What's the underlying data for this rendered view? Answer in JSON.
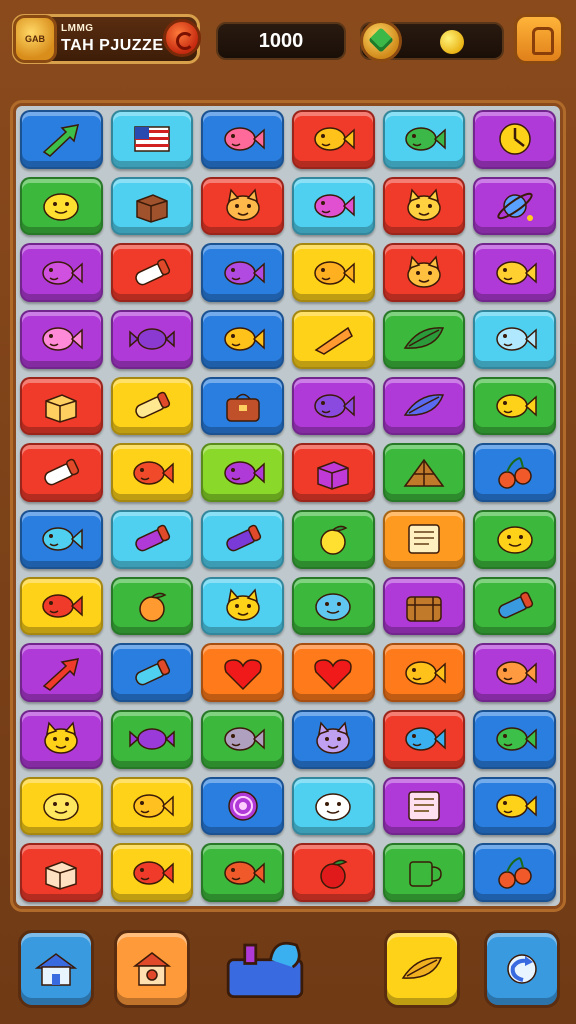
{
  "header": {
    "title_small": "LMMG",
    "title_main": "TAH PJUZZE",
    "coin_label": "GAB",
    "score": "1000"
  },
  "board": {
    "rows": 12,
    "cols": 6,
    "tiles": [
      [
        {
          "color": "#2a7ee0",
          "icon": "arrow-icon",
          "ic": "#3cc04a"
        },
        {
          "color": "#4fd0f0",
          "icon": "flag-icon",
          "ic": "#d02020"
        },
        {
          "color": "#2a7ee0",
          "icon": "fish-icon",
          "ic": "#ff6a9a"
        },
        {
          "color": "#f03a2a",
          "icon": "fish-icon",
          "ic": "#ffc21a"
        },
        {
          "color": "#4fd0f0",
          "icon": "fish-icon",
          "ic": "#3cb848"
        },
        {
          "color": "#b03ad8",
          "icon": "clock-icon",
          "ic": "#ffd21a"
        }
      ],
      [
        {
          "color": "#3cb83c",
          "icon": "blob-icon",
          "ic": "#ffe030"
        },
        {
          "color": "#4fd0f0",
          "icon": "box-icon",
          "ic": "#a0522d"
        },
        {
          "color": "#f03a2a",
          "icon": "cat-icon",
          "ic": "#ffb84a"
        },
        {
          "color": "#4fd0f0",
          "icon": "fish-icon",
          "ic": "#e050d0"
        },
        {
          "color": "#f03a2a",
          "icon": "cat-icon",
          "ic": "#ffd040"
        },
        {
          "color": "#b03ad8",
          "icon": "planet-icon",
          "ic": "#5aa0ff"
        }
      ],
      [
        {
          "color": "#b03ad8",
          "icon": "fish-icon",
          "ic": "#d050e0"
        },
        {
          "color": "#f03a2a",
          "icon": "tube-icon",
          "ic": "#ffffff"
        },
        {
          "color": "#2a7ee0",
          "icon": "fish-icon",
          "ic": "#b04ae0"
        },
        {
          "color": "#ffd21a",
          "icon": "fish-icon",
          "ic": "#ffb020"
        },
        {
          "color": "#f03a2a",
          "icon": "cat-icon",
          "ic": "#ffc040"
        },
        {
          "color": "#b03ad8",
          "icon": "fish-icon",
          "ic": "#ffd030"
        }
      ],
      [
        {
          "color": "#b03ad8",
          "icon": "fish-icon",
          "ic": "#ff8ad8"
        },
        {
          "color": "#b03ad8",
          "icon": "candy-icon",
          "ic": "#8a3ad0"
        },
        {
          "color": "#2a7ee0",
          "icon": "fish-icon",
          "ic": "#ffc21a"
        },
        {
          "color": "#ffd21a",
          "icon": "cone-icon",
          "ic": "#ff9a30"
        },
        {
          "color": "#3cb83c",
          "icon": "leaf-icon",
          "ic": "#2a9a3a"
        },
        {
          "color": "#4fd0f0",
          "icon": "fish-icon",
          "ic": "#b0e8ff"
        }
      ],
      [
        {
          "color": "#f03a2a",
          "icon": "box-icon",
          "ic": "#ffd060"
        },
        {
          "color": "#ffd21a",
          "icon": "tube-icon",
          "ic": "#ffe890"
        },
        {
          "color": "#2a7ee0",
          "icon": "bag-icon",
          "ic": "#c0502a"
        },
        {
          "color": "#b03ad8",
          "icon": "fish-icon",
          "ic": "#8a4ae0"
        },
        {
          "color": "#b03ad8",
          "icon": "leaf-icon",
          "ic": "#5a6af0"
        },
        {
          "color": "#3cb83c",
          "icon": "fish-icon",
          "ic": "#ffd21a"
        }
      ],
      [
        {
          "color": "#f03a2a",
          "icon": "tube-icon",
          "ic": "#ffffff"
        },
        {
          "color": "#ffd21a",
          "icon": "fish-icon",
          "ic": "#f04a2a"
        },
        {
          "color": "#8ad82a",
          "icon": "fish-icon",
          "ic": "#b03ad8"
        },
        {
          "color": "#f03a2a",
          "icon": "box-icon",
          "ic": "#c03ad8"
        },
        {
          "color": "#3cb83c",
          "icon": "tent-icon",
          "ic": "#c07a2a"
        },
        {
          "color": "#2a7ee0",
          "icon": "cherry-icon",
          "ic": "#f05a2a"
        }
      ],
      [
        {
          "color": "#2a7ee0",
          "icon": "fish-icon",
          "ic": "#4fd0f0"
        },
        {
          "color": "#4fd0f0",
          "icon": "tube-icon",
          "ic": "#b03ad8"
        },
        {
          "color": "#4fd0f0",
          "icon": "tube-icon",
          "ic": "#7a3ad8"
        },
        {
          "color": "#3cb83c",
          "icon": "fruit-icon",
          "ic": "#ffe030"
        },
        {
          "color": "#ff9a20",
          "icon": "note-icon",
          "ic": "#fff0c0"
        },
        {
          "color": "#3cb83c",
          "icon": "blob-icon",
          "ic": "#ffd21a"
        }
      ],
      [
        {
          "color": "#ffd21a",
          "icon": "fish-icon",
          "ic": "#f03a2a"
        },
        {
          "color": "#3cb83c",
          "icon": "fruit-icon",
          "ic": "#ff9a30"
        },
        {
          "color": "#4fd0f0",
          "icon": "cat-icon",
          "ic": "#ffd21a"
        },
        {
          "color": "#3cb83c",
          "icon": "blob-icon",
          "ic": "#60c8f0"
        },
        {
          "color": "#b03ad8",
          "icon": "chest-icon",
          "ic": "#c07a2a"
        },
        {
          "color": "#3cb83c",
          "icon": "tube-icon",
          "ic": "#3a9ae0"
        }
      ],
      [
        {
          "color": "#b03ad8",
          "icon": "arrow-icon",
          "ic": "#f03a2a"
        },
        {
          "color": "#2a7ee0",
          "icon": "tube-icon",
          "ic": "#4fd0f0"
        },
        {
          "color": "#ff7a1a",
          "icon": "heart-icon",
          "ic": "#f01a1a"
        },
        {
          "color": "#ff7a1a",
          "icon": "heart-icon",
          "ic": "#f01a1a"
        },
        {
          "color": "#ff7a1a",
          "icon": "fish-icon",
          "ic": "#ffc21a"
        },
        {
          "color": "#b03ad8",
          "icon": "fish-icon",
          "ic": "#ff9a40"
        }
      ],
      [
        {
          "color": "#b03ad8",
          "icon": "cat-icon",
          "ic": "#ffd21a"
        },
        {
          "color": "#3cb83c",
          "icon": "candy-icon",
          "ic": "#9a3ad8"
        },
        {
          "color": "#3cb83c",
          "icon": "fish-icon",
          "ic": "#b0a0c0"
        },
        {
          "color": "#2a7ee0",
          "icon": "cat-icon",
          "ic": "#c0a0f0"
        },
        {
          "color": "#f03a2a",
          "icon": "fish-icon",
          "ic": "#3ab0f0"
        },
        {
          "color": "#2a7ee0",
          "icon": "fish-icon",
          "ic": "#3cc04a"
        }
      ],
      [
        {
          "color": "#ffd21a",
          "icon": "blob-icon",
          "ic": "#ffe860"
        },
        {
          "color": "#ffd21a",
          "icon": "fish-icon",
          "ic": "#ffc020"
        },
        {
          "color": "#2a7ee0",
          "icon": "spiral-icon",
          "ic": "#b03ad8"
        },
        {
          "color": "#4fd0f0",
          "icon": "blob-icon",
          "ic": "#ffffff"
        },
        {
          "color": "#b03ad8",
          "icon": "note-icon",
          "ic": "#ffe0f0"
        },
        {
          "color": "#2a7ee0",
          "icon": "fish-icon",
          "ic": "#ffd21a"
        }
      ],
      [
        {
          "color": "#f03a2a",
          "icon": "box-icon",
          "ic": "#ffe0c0"
        },
        {
          "color": "#ffd21a",
          "icon": "fish-icon",
          "ic": "#f03a2a"
        },
        {
          "color": "#3cb83c",
          "icon": "fish-icon",
          "ic": "#f05a2a"
        },
        {
          "color": "#f03a2a",
          "icon": "fruit-icon",
          "ic": "#e01a1a"
        },
        {
          "color": "#3cb83c",
          "icon": "cup-icon",
          "ic": "#3cb83c"
        },
        {
          "color": "#2a7ee0",
          "icon": "cherry-icon",
          "ic": "#f05a2a"
        }
      ]
    ]
  },
  "toolbar": {
    "buttons": [
      {
        "name": "home-button",
        "icon": "house-icon",
        "color": "#3a9ae0"
      },
      {
        "name": "shop-button",
        "icon": "birdhouse-icon",
        "color": "#ff9a3a"
      },
      {
        "name": "toolbox-button",
        "icon": "toolbox-icon",
        "color": "#3a6ae0"
      },
      {
        "name": "hint-button",
        "icon": "leaf-icon",
        "color": "#ffd21a"
      },
      {
        "name": "undo-button",
        "icon": "undo-icon",
        "color": "#3a9ae0"
      }
    ]
  }
}
